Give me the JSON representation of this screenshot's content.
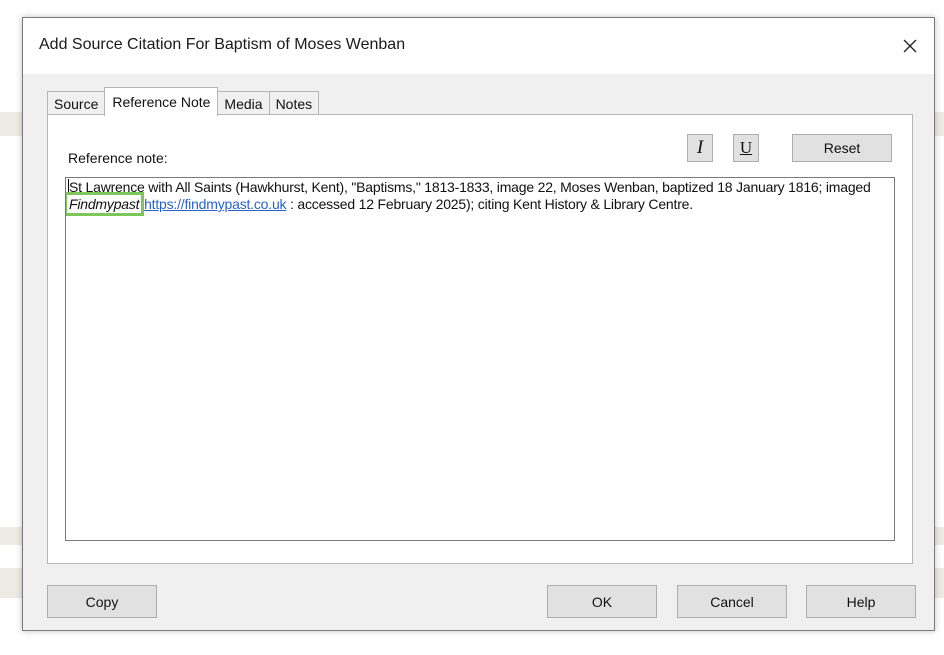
{
  "dialog": {
    "title": "Add Source Citation For Baptism of Moses Wenban",
    "close_icon": "close-icon"
  },
  "tabs": [
    {
      "label": "Source",
      "active": false
    },
    {
      "label": "Reference Note",
      "active": true
    },
    {
      "label": "Media",
      "active": false
    },
    {
      "label": "Notes",
      "active": false
    }
  ],
  "reference": {
    "label": "Reference note:",
    "italic_button": "I",
    "underline_button": "U",
    "reset_button": "Reset",
    "note": {
      "text_before": "St Lawrence with All Saints (Hawkhurst, Kent), \"Baptisms,\" 1813-1833, image 22, Moses Wenban, baptized 18 January 1816; imaged ",
      "italic_text": "Findmypast",
      "link_text": "https://findmypast.co.uk",
      "text_after": " : accessed 12 February 2025); citing Kent History & Library Centre.",
      "highlight_color": "#7cc65a",
      "link_color": "#2a63c8"
    }
  },
  "buttons": {
    "copy": "Copy",
    "ok": "OK",
    "cancel": "Cancel",
    "help": "Help"
  }
}
